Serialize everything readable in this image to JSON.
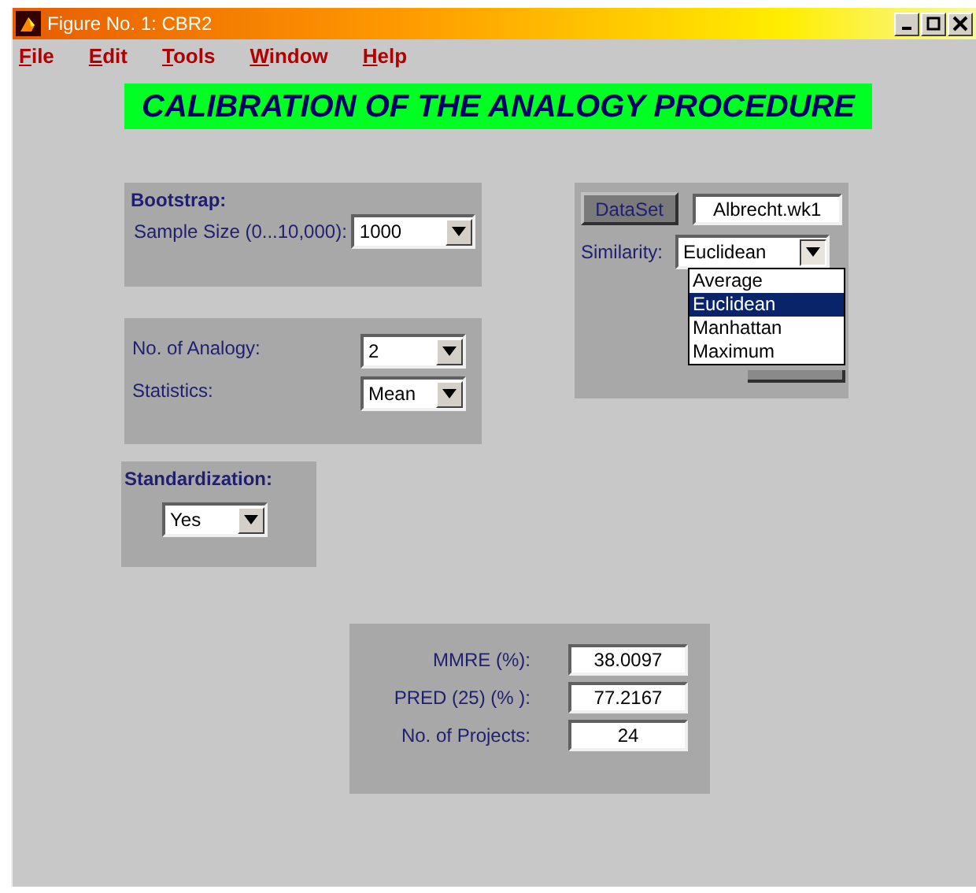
{
  "window": {
    "title": "Figure No. 1: CBR2"
  },
  "menu": [
    "File",
    "Edit",
    "Tools",
    "Window",
    "Help"
  ],
  "banner": "CALIBRATION OF THE ANALOGY PROCEDURE",
  "bootstrap": {
    "heading": "Bootstrap:",
    "sample_size_label": "Sample Size (0...10,000):",
    "sample_size": "1000"
  },
  "analogy": {
    "fields": [
      {
        "label": "No. of Analogy:",
        "value": "2"
      },
      {
        "label": "Statistics:",
        "value": "Mean"
      }
    ]
  },
  "standardization": {
    "heading": "Standardization:",
    "value": "Yes"
  },
  "dataset": {
    "button": "DataSet",
    "file": "Albrecht.wk1",
    "similarity_label": "Similarity:",
    "similarity": "Euclidean",
    "expanded": true,
    "options": [
      {
        "label": "Average",
        "selected": false
      },
      {
        "label": "Euclidean",
        "selected": true
      },
      {
        "label": "Manhattan",
        "selected": false
      },
      {
        "label": "Maximum",
        "selected": false
      }
    ]
  },
  "results": [
    {
      "label": "MMRE (%):",
      "value": "38.0097"
    },
    {
      "label": "PRED (25) (% ):",
      "value": "77.2167"
    },
    {
      "label": "No. of Projects:",
      "value": "24"
    }
  ]
}
